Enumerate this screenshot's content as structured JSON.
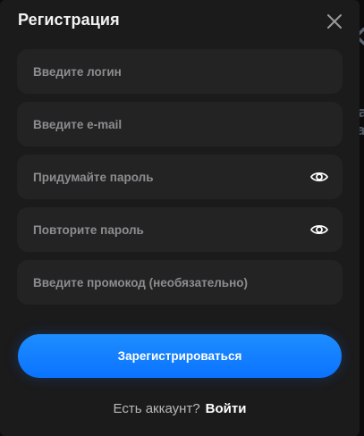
{
  "modal": {
    "title": "Регистрация",
    "close_icon": "close-icon"
  },
  "form": {
    "login": {
      "placeholder": "Введите логин",
      "value": ""
    },
    "email": {
      "placeholder": "Введите e-mail",
      "value": ""
    },
    "password": {
      "placeholder": "Придумайте пароль",
      "value": "",
      "toggle_icon": "eye-icon"
    },
    "password_repeat": {
      "placeholder": "Повторите пароль",
      "value": "",
      "toggle_icon": "eye-icon"
    },
    "promo": {
      "placeholder": "Введите промокод (необязательно)",
      "value": ""
    },
    "submit_label": "Зарегистрироваться"
  },
  "footer": {
    "question": "Есть аккаунт?",
    "login_link": "Войти"
  },
  "colors": {
    "modal_bg": "#1b1b1c",
    "field_bg": "#232324",
    "accent": "#0a73ff",
    "placeholder": "#8d8d90",
    "text": "#ffffff"
  }
}
